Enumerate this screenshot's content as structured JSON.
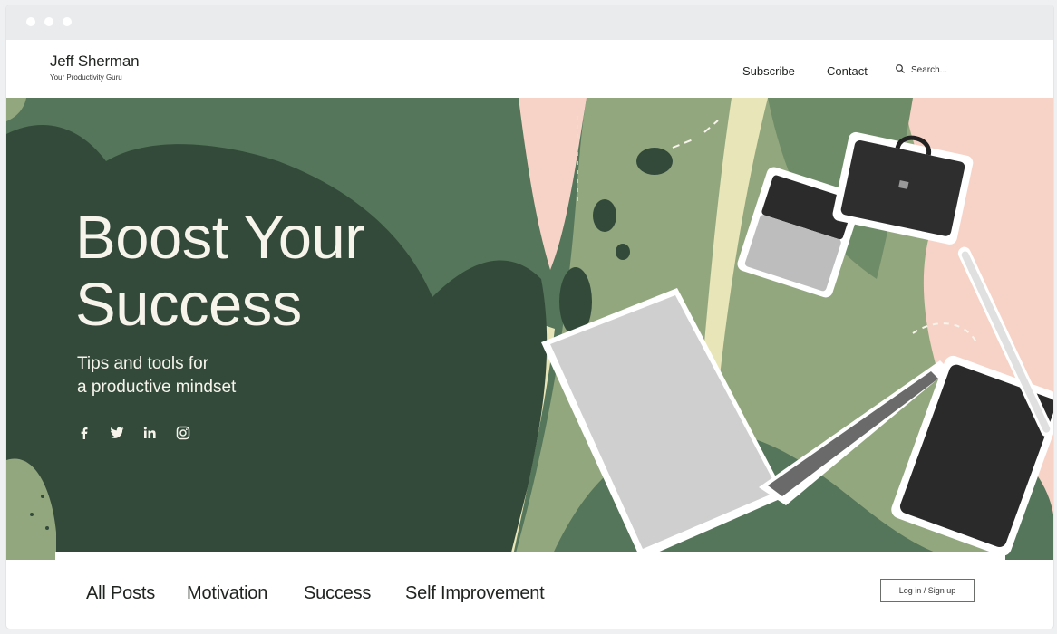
{
  "header": {
    "brand_name": "Jeff Sherman",
    "brand_tagline": "Your Productivity Guru",
    "nav": [
      {
        "label": "Subscribe"
      },
      {
        "label": "Contact"
      }
    ],
    "search": {
      "placeholder": "Search..."
    }
  },
  "hero": {
    "title_line1": "Boost Your",
    "title_line2": "Success",
    "subtitle_line1": "Tips and tools for",
    "subtitle_line2": "a productive mindset",
    "social_icons": [
      "facebook-icon",
      "twitter-icon",
      "linkedin-icon",
      "instagram-icon"
    ]
  },
  "categories": [
    {
      "label": "All Posts"
    },
    {
      "label": "Motivation"
    },
    {
      "label": "Success"
    },
    {
      "label": "Self Improvement"
    }
  ],
  "auth": {
    "label": "Log in / Sign up"
  },
  "colors": {
    "hero_dark": "#334a3b",
    "hero_mid": "#55765a",
    "hero_light": "#93a77f",
    "hero_pink": "#f6d3c6",
    "hero_cream": "#e8e6b8",
    "text_light": "#f7f4ec"
  }
}
